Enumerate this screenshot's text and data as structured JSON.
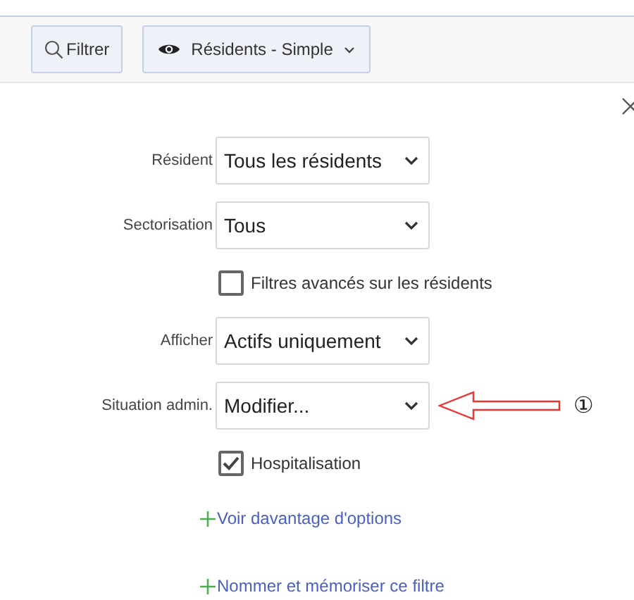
{
  "toolbar": {
    "filter_button": "Filtrer",
    "view_button": "Résidents - Simple"
  },
  "form": [
    {
      "kind": "select",
      "label": "Résident",
      "value": "Tous les résidents"
    },
    {
      "kind": "select",
      "label": "Sectorisation",
      "value": "Tous"
    },
    {
      "kind": "checkbox",
      "label": "Filtres avancés sur les résidents",
      "checked": false
    },
    {
      "kind": "select",
      "label": "Afficher",
      "value": "Actifs uniquement"
    },
    {
      "kind": "select",
      "label": "Situation admin.",
      "value": "Modifier...",
      "callout": "①"
    },
    {
      "kind": "checkbox",
      "label": "Hospitalisation",
      "checked": true
    }
  ],
  "links": [
    "Voir davantage d'options",
    "Nommer et mémoriser ce filtre"
  ]
}
